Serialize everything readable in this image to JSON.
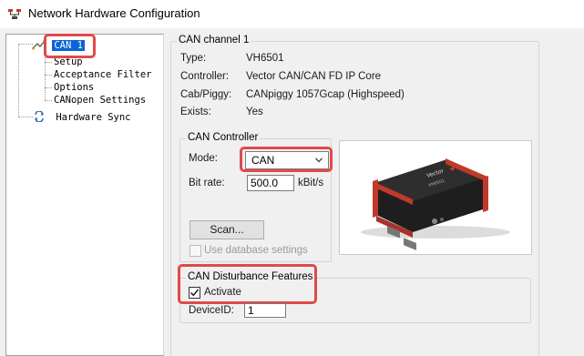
{
  "window": {
    "title": "Network Hardware Configuration"
  },
  "tree": {
    "root": "CAN 1",
    "children": [
      "Setup",
      "Acceptance Filter",
      "Options",
      "CANopen Settings"
    ],
    "sibling": "Hardware Sync"
  },
  "channel": {
    "group_title": "CAN channel 1",
    "rows": [
      {
        "label": "Type:",
        "value": "VH6501"
      },
      {
        "label": "Controller:",
        "value": "Vector CAN/CAN FD IP Core"
      },
      {
        "label": "Cab/Piggy:",
        "value": "CANpiggy 1057Gcap (Highspeed)"
      },
      {
        "label": "Exists:",
        "value": "Yes"
      }
    ]
  },
  "controller": {
    "group_title": "CAN Controller",
    "mode_label": "Mode:",
    "mode_value": "CAN",
    "bitrate_label": "Bit rate:",
    "bitrate_value": "500.0",
    "bitrate_unit": "kBit/s",
    "scan_label": "Scan...",
    "use_db_label": "Use database settings",
    "use_db_checked": false
  },
  "disturbance": {
    "group_title": "CAN Disturbance Features",
    "activate_label": "Activate",
    "activate_checked": true,
    "device_id_label": "DeviceID:",
    "device_id_value": "1"
  },
  "device_image": {
    "brand": "Vector",
    "model": "VH6501"
  },
  "colors": {
    "highlight": "#e04a4a",
    "selection": "#0a64d6"
  }
}
